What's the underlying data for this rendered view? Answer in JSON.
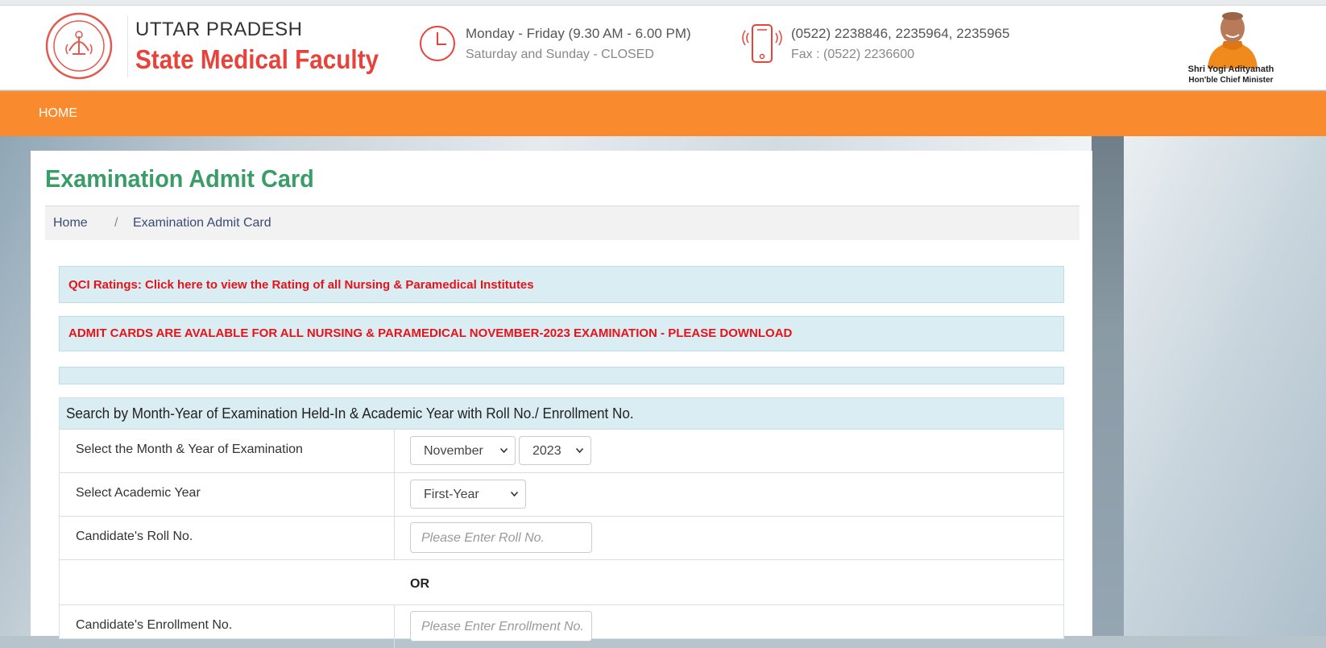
{
  "header": {
    "brand_line1": "UTTAR PRADESH",
    "brand_line2": "State Medical Faculty",
    "hours_line1": "Monday - Friday (9.30 AM - 6.00 PM)",
    "hours_line2": "Saturday and Sunday - CLOSED",
    "phone_line1": "(0522) 2238846, 2235964, 2235965",
    "phone_line2": "Fax : (0522) 2236600",
    "cm_name": "Shri Yogi Adityanath",
    "cm_title": "Hon'ble Chief Minister",
    "accent_color": "#e8433b"
  },
  "nav": {
    "items": [
      {
        "label": "HOME"
      }
    ],
    "bar_color": "#f98a2e"
  },
  "page": {
    "title": "Examination Admit Card",
    "title_color": "#3a9d68"
  },
  "breadcrumb": {
    "home": "Home",
    "separator": "/",
    "current": "Examination Admit Card"
  },
  "alerts": [
    {
      "text": "QCI Ratings: Click here to view the Rating of all Nursing & Paramedical Institutes"
    },
    {
      "text": "ADMIT CARDS ARE AVALABLE FOR ALL NURSING & PARAMEDICAL NOVEMBER-2023 EXAMINATION - PLEASE DOWNLOAD"
    },
    {
      "text": ""
    }
  ],
  "search": {
    "title": "Search by Month-Year of Examination Held-In & Academic Year with Roll No./ Enrollment No.",
    "month_year_label": "Select the Month & Year of Examination",
    "month_value": "November",
    "year_value": "2023",
    "academic_year_label": "Select Academic Year",
    "academic_year_value": "First-Year",
    "roll_label": "Candidate's Roll No.",
    "roll_placeholder": "Please Enter Roll No.",
    "or_text": "OR",
    "enrollment_label": "Candidate's Enrollment No.",
    "enrollment_placeholder": "Please Enter Enrollment No."
  }
}
